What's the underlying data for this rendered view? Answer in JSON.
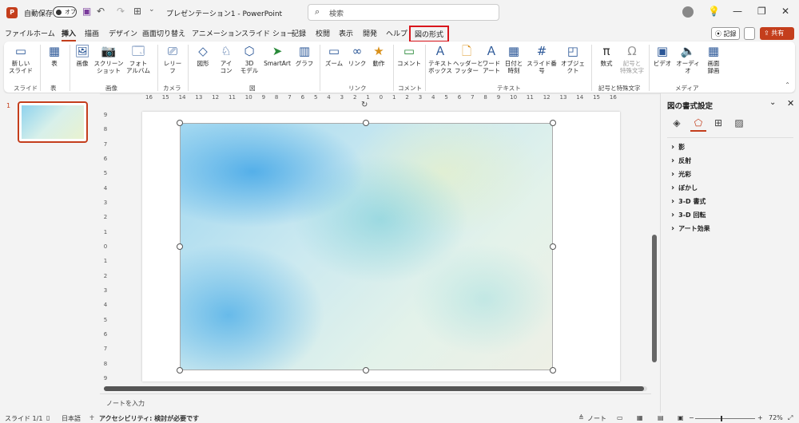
{
  "titlebar": {
    "autosave_label": "自動保存",
    "autosave_state": "オフ",
    "doc_title": "プレゼンテーション1 - PowerPoint",
    "search_placeholder": "検索"
  },
  "tabs": [
    "ファイル",
    "ホーム",
    "挿入",
    "描画",
    "デザイン",
    "画面切り替え",
    "アニメーション",
    "スライド ショー",
    "記録",
    "校閲",
    "表示",
    "開発",
    "ヘルプ",
    "図の形式"
  ],
  "active_tab": "挿入",
  "right_buttons": {
    "record": "記録",
    "share": "共有"
  },
  "ribbon": {
    "buttons": {
      "new_slide": "新しい\nスライド",
      "table": "表",
      "image": "画像",
      "screenshot": "スクリーン\nショット",
      "photo_album": "フォト\nアルバム",
      "reel": "レリー\nフ",
      "shapes": "図形",
      "icons": "アイ\nコン",
      "models3d": "3D\nモデル",
      "smartart": "SmartArt",
      "chart": "グラフ",
      "zoom": "ズーム",
      "link": "リンク",
      "action": "動作",
      "comment": "コメント",
      "textbox": "テキスト\nボックス",
      "header_footer": "ヘッダーと\nフッター",
      "wordart": "ワード\nアート",
      "datetime": "日付と\n時刻",
      "slide_number": "スライド番号",
      "object": "オブジェクト",
      "equation": "数式",
      "symbol": "記号と\n特殊文字",
      "video": "ビデオ",
      "audio": "オーディオ",
      "screen_recording": "画面\n録画"
    },
    "groups": {
      "slides": "スライド",
      "tables": "表",
      "images": "画像",
      "camera": "カメラ",
      "illustrations": "図",
      "links": "リンク",
      "comments": "コメント",
      "text": "テキスト",
      "symbols": "記号と特殊文字",
      "media": "メディア"
    }
  },
  "thumbnails": [
    {
      "number": "1"
    }
  ],
  "ruler_h": [
    "16",
    "15",
    "14",
    "13",
    "12",
    "11",
    "10",
    "9",
    "8",
    "7",
    "6",
    "5",
    "4",
    "3",
    "2",
    "1",
    "0",
    "1",
    "2",
    "3",
    "4",
    "5",
    "6",
    "7",
    "8",
    "9",
    "10",
    "11",
    "12",
    "13",
    "14",
    "15",
    "16"
  ],
  "ruler_v": [
    "9",
    "8",
    "7",
    "6",
    "5",
    "4",
    "3",
    "2",
    "1",
    "0",
    "1",
    "2",
    "3",
    "4",
    "5",
    "6",
    "7",
    "8",
    "9"
  ],
  "notes_placeholder": "ノートを入力",
  "format_panel": {
    "title": "図の書式設定",
    "sections": [
      "影",
      "反射",
      "光彩",
      "ぼかし",
      "3-D 書式",
      "3-D 回転",
      "アート効果"
    ]
  },
  "status": {
    "slide": "スライド 1/1",
    "language": "日本語",
    "accessibility": "アクセシビリティ: 検討が必要です",
    "notes": "ノート",
    "zoom": "72%"
  },
  "colors": {
    "accent": "#c43e1c",
    "highlight_border": "#d9161c"
  }
}
